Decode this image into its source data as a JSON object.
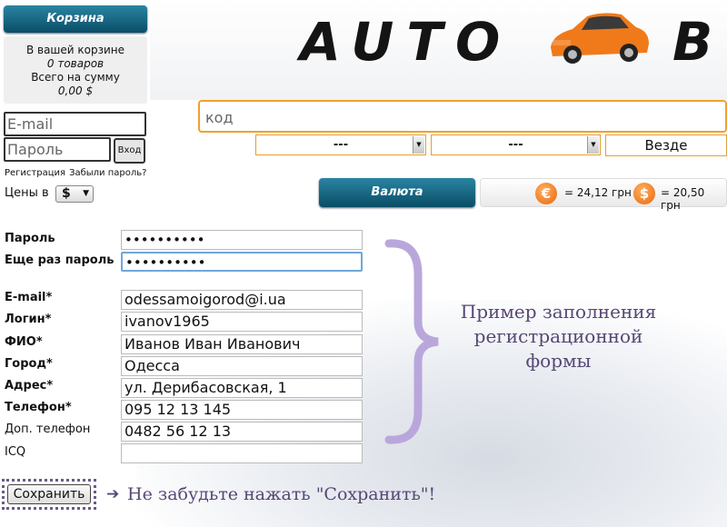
{
  "cart": {
    "title": "Корзина",
    "line1": "В вашей корзине",
    "items": "0 товаров",
    "line3": "Всего на сумму",
    "total": "0,00 $"
  },
  "login": {
    "email_placeholder": "E-mail",
    "password_placeholder": "Пароль",
    "enter_label": "Вход",
    "register_link": "Регистрация",
    "forgot_link": "Забыли пароль?",
    "prices_in_label": "Цены в",
    "currency_selected": "$"
  },
  "header": {
    "logo_text": "AUTO",
    "logo_text_tail": "B"
  },
  "search": {
    "placeholder": "код",
    "dropdown1": "---",
    "dropdown2": "---",
    "scope": "Везде"
  },
  "currency": {
    "button_label": "Валюта",
    "euro_symbol": "€",
    "euro_rate": "= 24,12 грн",
    "usd_symbol": "$",
    "usd_rate": "= 20,50 грн"
  },
  "form": {
    "password_label": "Пароль",
    "password_value": "••••••••••",
    "password2_label": "Еще раз пароль",
    "password2_value": "••••••••••",
    "email_label": "E-mail*",
    "email_value": "odessamoigorod@i.ua",
    "login_label": "Логин*",
    "login_value": "ivanov1965",
    "fio_label": "ФИО*",
    "fio_value": "Иванов Иван Иванович",
    "city_label": "Город*",
    "city_value": "Одесса",
    "address_label": "Адрес*",
    "address_value": "ул. Дерибасовская, 1",
    "phone_label": "Телефон*",
    "phone_value": "095 12 13 145",
    "phone2_label": "Доп. телефон",
    "phone2_value": "0482 56 12 13",
    "icq_label": "ICQ",
    "icq_value": "",
    "save_label": "Сохранить"
  },
  "annotations": {
    "example_line1": "Пример заполнения",
    "example_line2": "регистрационной",
    "example_line3": "формы",
    "save_hint": "Не забудьте нажать \"Сохранить\"!"
  },
  "colors": {
    "accent_blue": "#0a4d66",
    "annotation_purple": "#574774",
    "brace_purple": "#b9a7dc",
    "coin_orange": "#e8660c",
    "search_border": "#f0a030"
  }
}
